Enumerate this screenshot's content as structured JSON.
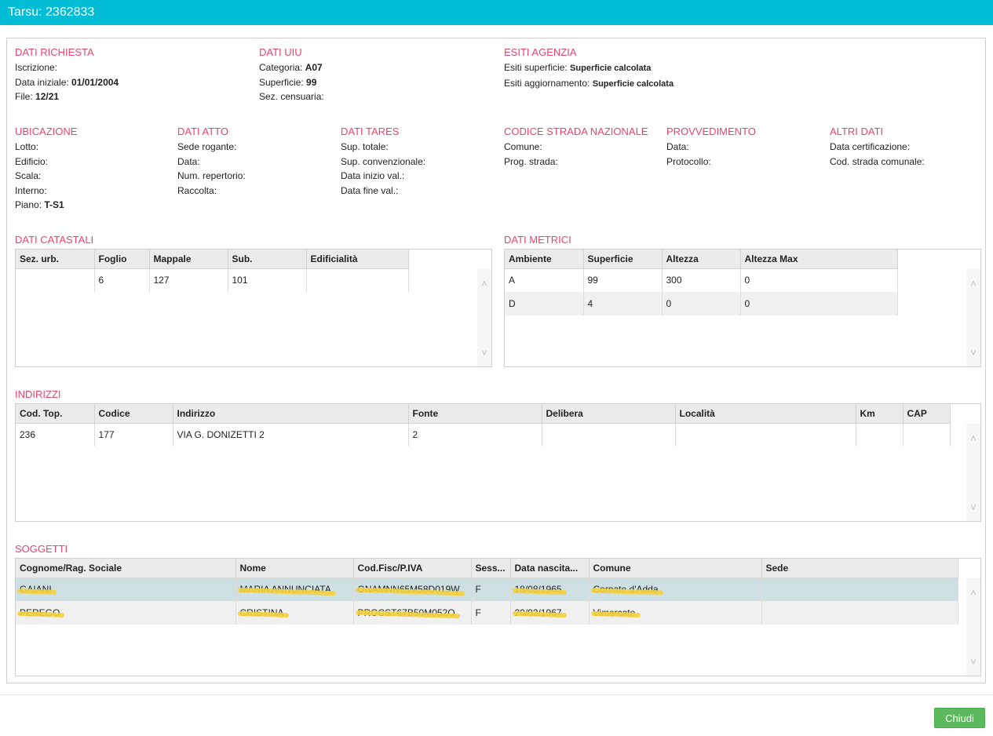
{
  "window": {
    "title": "Tarsu: 2362833"
  },
  "dati_richiesta": {
    "title": "DATI RICHIESTA",
    "iscrizione_label": "Iscrizione:",
    "data_iniziale_label": "Data iniziale:",
    "data_iniziale_value": "01/01/2004",
    "file_label": "File:",
    "file_value": "12/21"
  },
  "dati_uiu": {
    "title": "DATI UIU",
    "categoria_label": "Categoria:",
    "categoria_value": "A07",
    "superficie_label": "Superficie:",
    "superficie_value": "99",
    "sez_censuaria_label": "Sez. censuaria:"
  },
  "esiti_agenzia": {
    "title": "ESITI AGENZIA",
    "esiti_superficie_label": "Esiti superficie:",
    "esiti_superficie_value": "Superficie calcolata",
    "esiti_aggiornamento_label": "Esiti aggiornamento:",
    "esiti_aggiornamento_value": "Superficie calcolata"
  },
  "ubicazione": {
    "title": "UBICAZIONE",
    "lotto_label": "Lotto:",
    "edificio_label": "Edificio:",
    "scala_label": "Scala:",
    "interno_label": "Interno:",
    "piano_label": "Piano:",
    "piano_value": "T-S1"
  },
  "dati_atto": {
    "title": "DATI ATTO",
    "sede_rogante_label": "Sede rogante:",
    "data_label": "Data:",
    "num_repertorio_label": "Num. repertorio:",
    "raccolta_label": "Raccolta:"
  },
  "dati_tares": {
    "title": "DATI TARES",
    "sup_totale_label": "Sup. totale:",
    "sup_convenzionale_label": "Sup. convenzionale:",
    "data_inizio_label": "Data inizio val.:",
    "data_fine_label": "Data fine val.:"
  },
  "codice_strada": {
    "title": "CODICE STRADA NAZIONALE",
    "comune_label": "Comune:",
    "prog_strada_label": "Prog. strada:"
  },
  "provvedimento": {
    "title": "PROVVEDIMENTO",
    "data_label": "Data:",
    "protocollo_label": "Protocollo:"
  },
  "altri_dati": {
    "title": "ALTRI DATI",
    "data_certificazione_label": "Data certificazione:",
    "cod_strada_comunale_label": "Cod. strada comunale:"
  },
  "dati_catastali": {
    "title": "DATI CATASTALI",
    "columns": [
      "Sez. urb.",
      "Foglio",
      "Mappale",
      "Sub.",
      "Edificialità"
    ],
    "rows": [
      [
        "",
        "6",
        "127",
        "101",
        ""
      ]
    ]
  },
  "dati_metrici": {
    "title": "DATI METRICI",
    "columns": [
      "Ambiente",
      "Superficie",
      "Altezza",
      "Altezza Max"
    ],
    "rows": [
      [
        "A",
        "99",
        "300",
        "0"
      ],
      [
        "D",
        "4",
        "0",
        "0"
      ]
    ]
  },
  "indirizzi": {
    "title": "INDIRIZZI",
    "columns": [
      "Cod. Top.",
      "Codice",
      "Indirizzo",
      "Fonte",
      "Delibera",
      "Località",
      "Km",
      "CAP"
    ],
    "rows": [
      [
        "236",
        "177",
        "VIA G. DONIZETTI 2",
        "2",
        "",
        "",
        "",
        ""
      ]
    ]
  },
  "soggetti": {
    "title": "SOGGETTI",
    "columns": [
      "Cognome/Rag. Sociale",
      "Nome",
      "Cod.Fisc/P.IVA",
      "Sess...",
      "Data nascita...",
      "Comune",
      "Sede"
    ],
    "rows": [
      [
        "GAIANI",
        "MARIA ANNUNCIATA",
        "GNAMNN65M58D019W",
        "F",
        "18/08/1965",
        "Cornate d'Adda",
        ""
      ],
      [
        "PEREGO",
        "CRISTINA",
        "PRGCST67B50M052O",
        "F",
        "20/02/1967",
        "Vimercate",
        ""
      ]
    ]
  },
  "footer": {
    "close_label": "Chiudi"
  }
}
